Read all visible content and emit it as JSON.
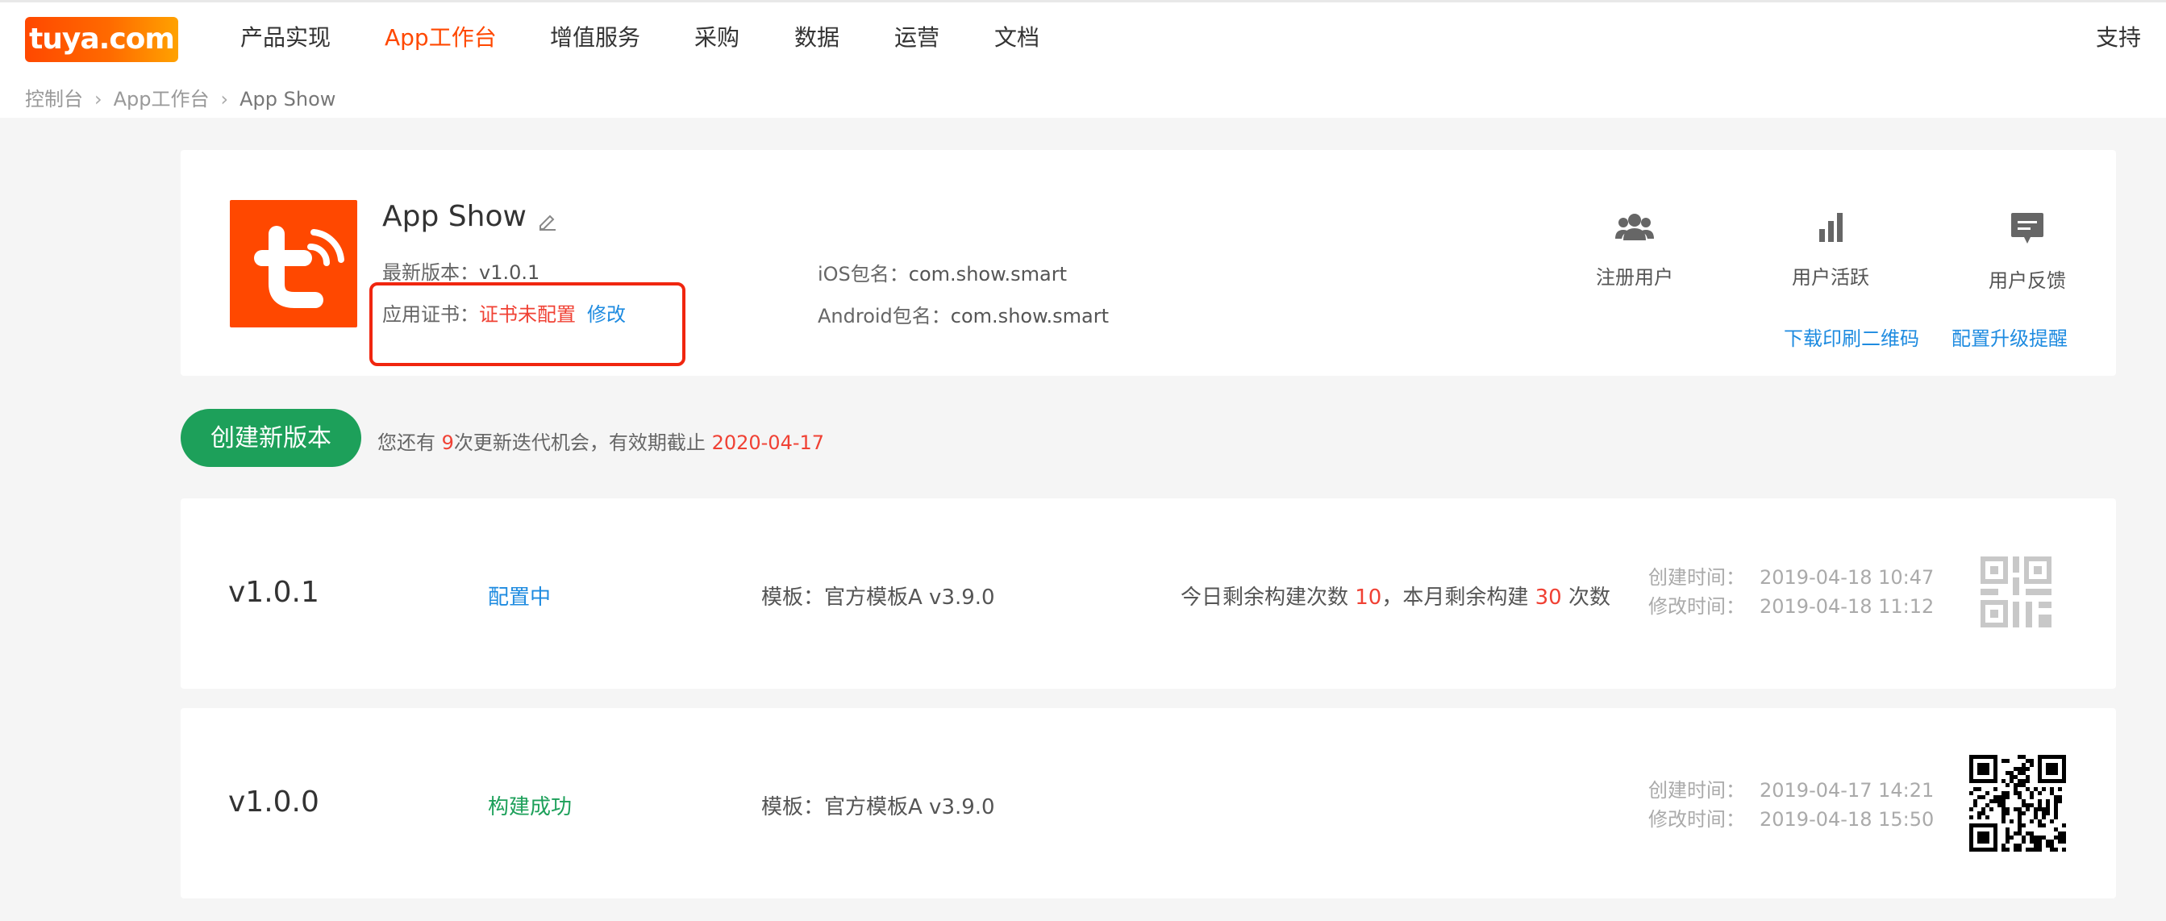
{
  "logo_text": "tuya.com",
  "nav": {
    "items": [
      "产品实现",
      "App工作台",
      "增值服务",
      "采购",
      "数据",
      "运营",
      "文档"
    ],
    "active_index": 1,
    "support_label": "支持"
  },
  "breadcrumb": [
    "控制台",
    "App工作台",
    "App Show"
  ],
  "app": {
    "name": "App Show",
    "latest_version_label": "最新版本：",
    "latest_version": "v1.0.1",
    "cert_label": "应用证书：",
    "cert_status": "证书未配置",
    "cert_edit": "修改",
    "ios_label": "iOS包名：",
    "ios_package": "com.show.smart",
    "android_label": "Android包名：",
    "android_package": "com.show.smart"
  },
  "stats": [
    {
      "label": "注册用户",
      "icon": "users-icon"
    },
    {
      "label": "用户活跃",
      "icon": "bar-chart-icon"
    },
    {
      "label": "用户反馈",
      "icon": "chat-icon"
    }
  ],
  "links": {
    "download_qr": "下载印刷二维码",
    "config_upgrade": "配置升级提醒"
  },
  "create": {
    "button_label": "创建新版本",
    "note_prefix": "您还有 ",
    "remaining": "9",
    "note_mid": "次更新迭代机会，有效期截止 ",
    "expiry": "2020-04-17"
  },
  "versions": [
    {
      "version": "v1.0.1",
      "status": "配置中",
      "template": "模板：官方模板A v3.9.0",
      "build_prefix": "今日剩余构建次数 ",
      "today_left": "10",
      "build_mid": "，本月剩余构建 ",
      "month_left": "30",
      "build_suffix": " 次数",
      "created_label": "创建时间：",
      "created": "2019-04-18 10:47",
      "modified_label": "修改时间：",
      "modified": "2019-04-18 11:12"
    },
    {
      "version": "v1.0.0",
      "status": "构建成功",
      "template": "模板：官方模板A v3.9.0",
      "created_label": "创建时间：",
      "created": "2019-04-17 14:21",
      "modified_label": "修改时间：",
      "modified": "2019-04-18 15:50"
    }
  ],
  "colors": {
    "brand": "#ff4800",
    "link": "#1e8be0",
    "success": "#1da05a",
    "warning": "#f04134"
  }
}
